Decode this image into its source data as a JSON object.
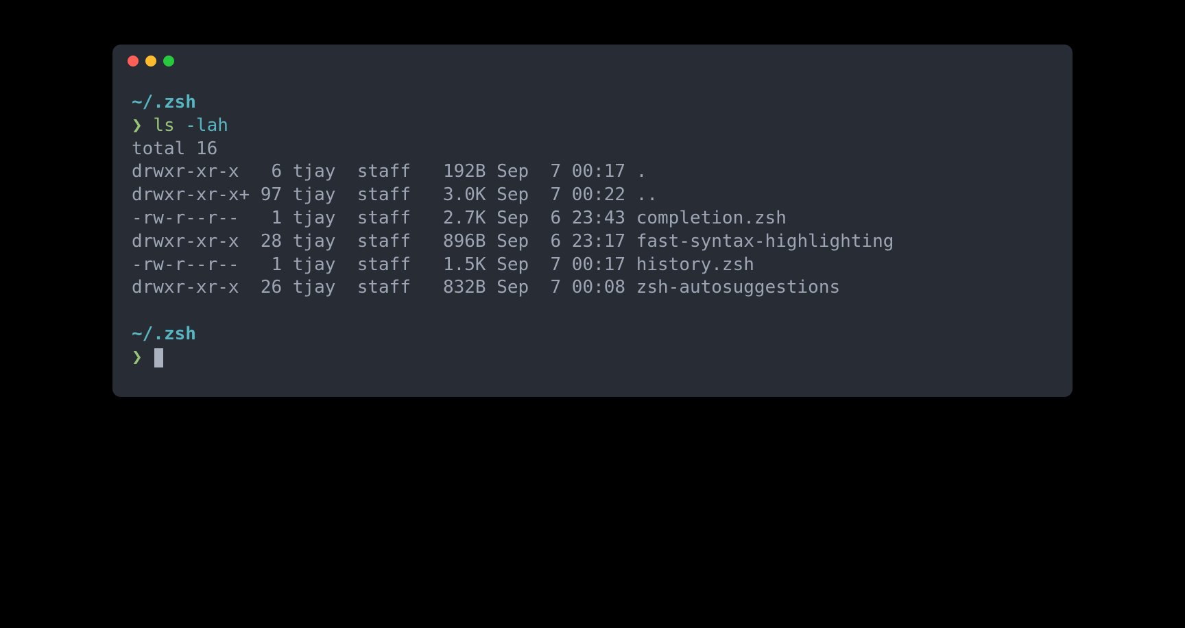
{
  "prompt1": {
    "path": "~/.zsh",
    "arrow": "❯",
    "command_name": "ls",
    "command_flags": "-lah"
  },
  "output": {
    "total": "total 16",
    "rows": [
      "drwxr-xr-x   6 tjay  staff   192B Sep  7 00:17 .",
      "drwxr-xr-x+ 97 tjay  staff   3.0K Sep  7 00:22 ..",
      "-rw-r--r--   1 tjay  staff   2.7K Sep  6 23:43 completion.zsh",
      "drwxr-xr-x  28 tjay  staff   896B Sep  6 23:17 fast-syntax-highlighting",
      "-rw-r--r--   1 tjay  staff   1.5K Sep  7 00:17 history.zsh",
      "drwxr-xr-x  26 tjay  staff   832B Sep  7 00:08 zsh-autosuggestions"
    ]
  },
  "prompt2": {
    "path": "~/.zsh",
    "arrow": "❯"
  }
}
